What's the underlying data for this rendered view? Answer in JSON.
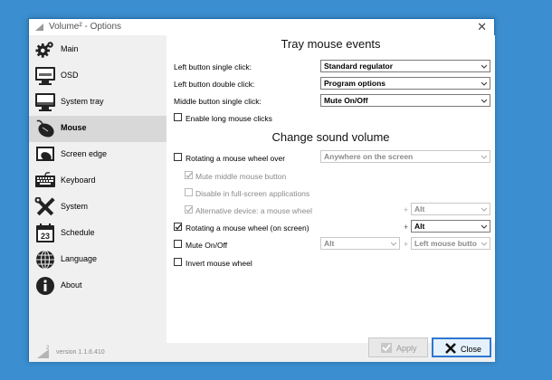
{
  "window": {
    "title": "Volume² - Options",
    "close_glyph": "✕"
  },
  "sidebar": {
    "items": [
      {
        "label": "Main",
        "icon": "gear-icon",
        "active": false
      },
      {
        "label": "OSD",
        "icon": "monitor-icon",
        "active": false
      },
      {
        "label": "System tray",
        "icon": "system-tray-icon",
        "active": false
      },
      {
        "label": "Mouse",
        "icon": "mouse-icon",
        "active": true
      },
      {
        "label": "Screen edge",
        "icon": "screen-edge-icon",
        "active": false
      },
      {
        "label": "Keyboard",
        "icon": "keyboard-icon",
        "active": false
      },
      {
        "label": "System",
        "icon": "tools-icon",
        "active": false
      },
      {
        "label": "Schedule",
        "icon": "calendar-icon",
        "active": false
      },
      {
        "label": "Language",
        "icon": "globe-icon",
        "active": false
      },
      {
        "label": "About",
        "icon": "info-icon",
        "active": false
      }
    ],
    "calendar_day": "23",
    "version": "version 1.1.6.410"
  },
  "tray_mouse_events": {
    "title": "Tray mouse events",
    "left_single_label": "Left button single click:",
    "left_single_value": "Standard regulator",
    "left_double_label": "Left button double click:",
    "left_double_value": "Program options",
    "middle_single_label": "Middle button single click:",
    "middle_single_value": "Mute On/Off",
    "long_clicks_label": "Enable long mouse clicks",
    "long_clicks_checked": false
  },
  "change_sound_volume": {
    "title": "Change sound volume",
    "rotating_wheel_label": "Rotating a mouse wheel over",
    "rotating_wheel_checked": false,
    "rotating_wheel_value": "Anywhere on the screen",
    "mute_middle_label": "Mute middle mouse button",
    "mute_middle_checked": true,
    "disable_fullscreen_label": "Disable in full-screen applications",
    "disable_fullscreen_checked": false,
    "alt_device_label": "Alternative device: a mouse wheel",
    "alt_device_checked": true,
    "alt_device_modifier": "Alt",
    "rotating_on_screen_label": "Rotating a mouse wheel (on screen)",
    "rotating_on_screen_checked": true,
    "rotating_on_screen_modifier": "Alt",
    "mute_onoff_label": "Mute On/Off",
    "mute_onoff_checked": false,
    "mute_onoff_modifier": "Alt",
    "mute_onoff_button": "Left mouse butto",
    "invert_wheel_label": "Invert mouse wheel",
    "invert_wheel_checked": false,
    "plus_sign": "+"
  },
  "footer": {
    "apply_label": "Apply",
    "close_label": "Close"
  },
  "colors": {
    "desktop": "#3b8fd0",
    "sidebar_bg": "#f0f0f0",
    "active_item_bg": "#d8d8d8",
    "primary_button_border": "#2f77d2"
  }
}
